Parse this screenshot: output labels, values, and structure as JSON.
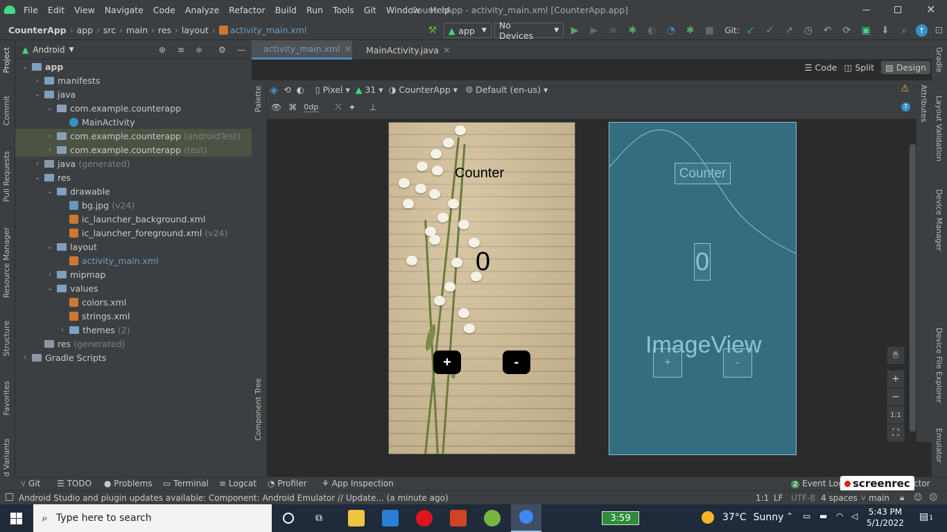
{
  "menubar": {
    "items": [
      "File",
      "Edit",
      "View",
      "Navigate",
      "Code",
      "Analyze",
      "Refactor",
      "Build",
      "Run",
      "Tools",
      "Git",
      "Window",
      "Help"
    ],
    "title": "CounterApp - activity_main.xml [CounterApp.app]"
  },
  "navbar": {
    "crumbs": [
      "CounterApp",
      "app",
      "src",
      "main",
      "res",
      "layout",
      "activity_main.xml"
    ],
    "run_config": "app",
    "device": "No Devices",
    "git_label": "Git:"
  },
  "left_strip": {
    "tabs": [
      "Project",
      "Commit",
      "Pull Requests",
      "Resource Manager",
      "Structure",
      "Favorites",
      "d Variants"
    ]
  },
  "project": {
    "view_mode": "Android",
    "tree": [
      {
        "label": "app",
        "extra": "",
        "type": "module"
      },
      {
        "label": "manifests",
        "extra": "",
        "type": "folder"
      },
      {
        "label": "java",
        "extra": "",
        "type": "folder"
      },
      {
        "label": "com.example.counterapp",
        "extra": "",
        "type": "package"
      },
      {
        "label": "MainActivity",
        "extra": "",
        "type": "class"
      },
      {
        "label": "com.example.counterapp",
        "extra": "(androidTest)",
        "type": "package"
      },
      {
        "label": "com.example.counterapp",
        "extra": "(test)",
        "type": "package"
      },
      {
        "label": "java",
        "extra": "(generated)",
        "type": "folder"
      },
      {
        "label": "res",
        "extra": "",
        "type": "folder"
      },
      {
        "label": "drawable",
        "extra": "",
        "type": "folder"
      },
      {
        "label": "bg.jpg",
        "extra": "(v24)",
        "type": "image"
      },
      {
        "label": "ic_launcher_background.xml",
        "extra": "",
        "type": "xml"
      },
      {
        "label": "ic_launcher_foreground.xml",
        "extra": "(v24)",
        "type": "xml"
      },
      {
        "label": "layout",
        "extra": "",
        "type": "folder"
      },
      {
        "label": "activity_main.xml",
        "extra": "",
        "type": "xml"
      },
      {
        "label": "mipmap",
        "extra": "",
        "type": "folder"
      },
      {
        "label": "values",
        "extra": "",
        "type": "folder"
      },
      {
        "label": "colors.xml",
        "extra": "",
        "type": "xml"
      },
      {
        "label": "strings.xml",
        "extra": "",
        "type": "xml"
      },
      {
        "label": "themes",
        "extra": "(2)",
        "type": "folder"
      },
      {
        "label": "res",
        "extra": "(generated)",
        "type": "folder"
      },
      {
        "label": "Gradle Scripts",
        "extra": "",
        "type": "gradle"
      }
    ]
  },
  "editor": {
    "tabs": [
      "activity_main.xml",
      "MainActivity.java"
    ],
    "modes": [
      "Code",
      "Split",
      "Design"
    ],
    "designbar": {
      "device": "Pixel",
      "api": "31",
      "theme": "CounterApp",
      "locale": "Default (en-us)",
      "margin": "0dp"
    },
    "palette_label": "Palette",
    "component_tree_label": "Component Tree"
  },
  "preview": {
    "title": "Counter",
    "count": "0",
    "plus": "+",
    "minus": "-"
  },
  "blueprint": {
    "title": "Counter",
    "count": "0",
    "imageview": "ImageView",
    "plus": "+",
    "minus": "-"
  },
  "zoom": {
    "fit": "1:1"
  },
  "right_strip": {
    "tabs": [
      "Gradle",
      "Layout Validation",
      "Device Manager",
      "Device File Explorer",
      "Emulator"
    ],
    "attributes": "Attributes"
  },
  "bottom_tabs": [
    "Git",
    "TODO",
    "Problems",
    "Terminal",
    "Logcat",
    "Profiler",
    "App Inspection",
    "Event Log",
    "ctor"
  ],
  "screenrec": "screenrec",
  "status": {
    "message": "Android Studio and plugin updates available: Component: Android Emulator // Update... (a minute ago)",
    "pos": "1:1",
    "lf": "LF",
    "enc": "UTF-8",
    "indent": "4 spaces",
    "branch": "main"
  },
  "taskbar": {
    "search": "Type here to search",
    "battery": "3:59",
    "temp": "37°C",
    "weather": "Sunny",
    "time": "5:43 PM",
    "date": "5/1/2022",
    "notif": "1"
  }
}
